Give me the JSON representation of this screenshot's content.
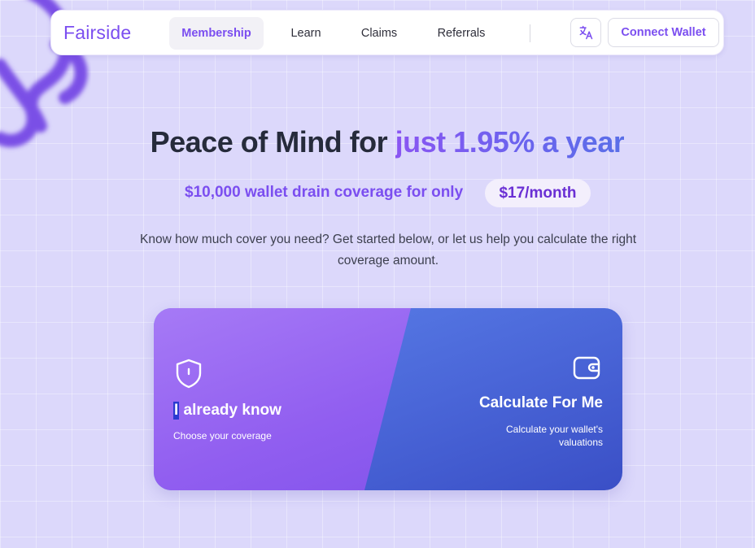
{
  "nav": {
    "logo": "Fairside",
    "items": [
      {
        "label": "Membership",
        "active": true
      },
      {
        "label": "Learn"
      },
      {
        "label": "Claims"
      },
      {
        "label": "Referrals"
      }
    ],
    "translate_icon": "translate-icon",
    "connect_label": "Connect Wallet"
  },
  "hero": {
    "headline_lead": "Peace of Mind for ",
    "headline_accent": "just 1.95% a year",
    "subline": "$10,000 wallet drain coverage for only",
    "price": "$17/month",
    "description": "Know how much cover you need? Get started below, or let us help you calculate the right coverage amount."
  },
  "cards": {
    "left": {
      "icon": "shield-icon",
      "title_first": "I",
      "title_rest": " already know",
      "subtitle": "Choose your coverage"
    },
    "right": {
      "icon": "wallet-icon",
      "title": "Calculate For Me",
      "subtitle": "Calculate your wallet's valuations"
    }
  },
  "colors": {
    "brand": "#7b4ef0",
    "left_card": "#915ef0",
    "right_card": "#4a66d8",
    "headline": "#262b3b"
  }
}
